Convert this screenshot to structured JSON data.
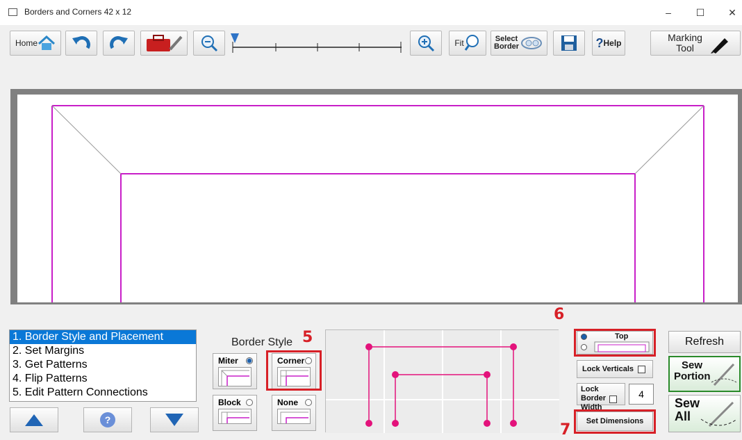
{
  "window": {
    "title": "Borders and Corners   42 x 12",
    "controls": [
      "–",
      "☐",
      "✕"
    ]
  },
  "toolbar": {
    "home_label": "Home",
    "fit_label": "Fit",
    "select_border_label": "Select Border",
    "help_label": "Help",
    "marking_tool_label": "Marking Tool"
  },
  "steps": [
    "1. Border Style and Placement",
    "2. Set Margins",
    "3. Get Patterns",
    "4. Flip Patterns",
    "5. Edit Pattern Connections"
  ],
  "border_style": {
    "title": "Border Style",
    "miter": "Miter",
    "corner": "Corner",
    "block": "Block",
    "none": "None",
    "selected": "Miter"
  },
  "placement": {
    "top_label": "Top",
    "selected": "Top"
  },
  "controls": {
    "lock_verticals": "Lock Verticals",
    "lock_border_width": "Lock Border Width",
    "border_width_value": "4",
    "set_dimensions": "Set Dimensions",
    "refresh": "Refresh",
    "sew_portion": "Sew Portion",
    "sew_all": "Sew All"
  },
  "annotations": {
    "five": "5",
    "six": "6",
    "seven": "7"
  },
  "colors": {
    "border_line": "#c81ec8",
    "highlight_red": "#d72027",
    "selection_blue": "#0a78d7",
    "node_pink": "#e3127b"
  }
}
